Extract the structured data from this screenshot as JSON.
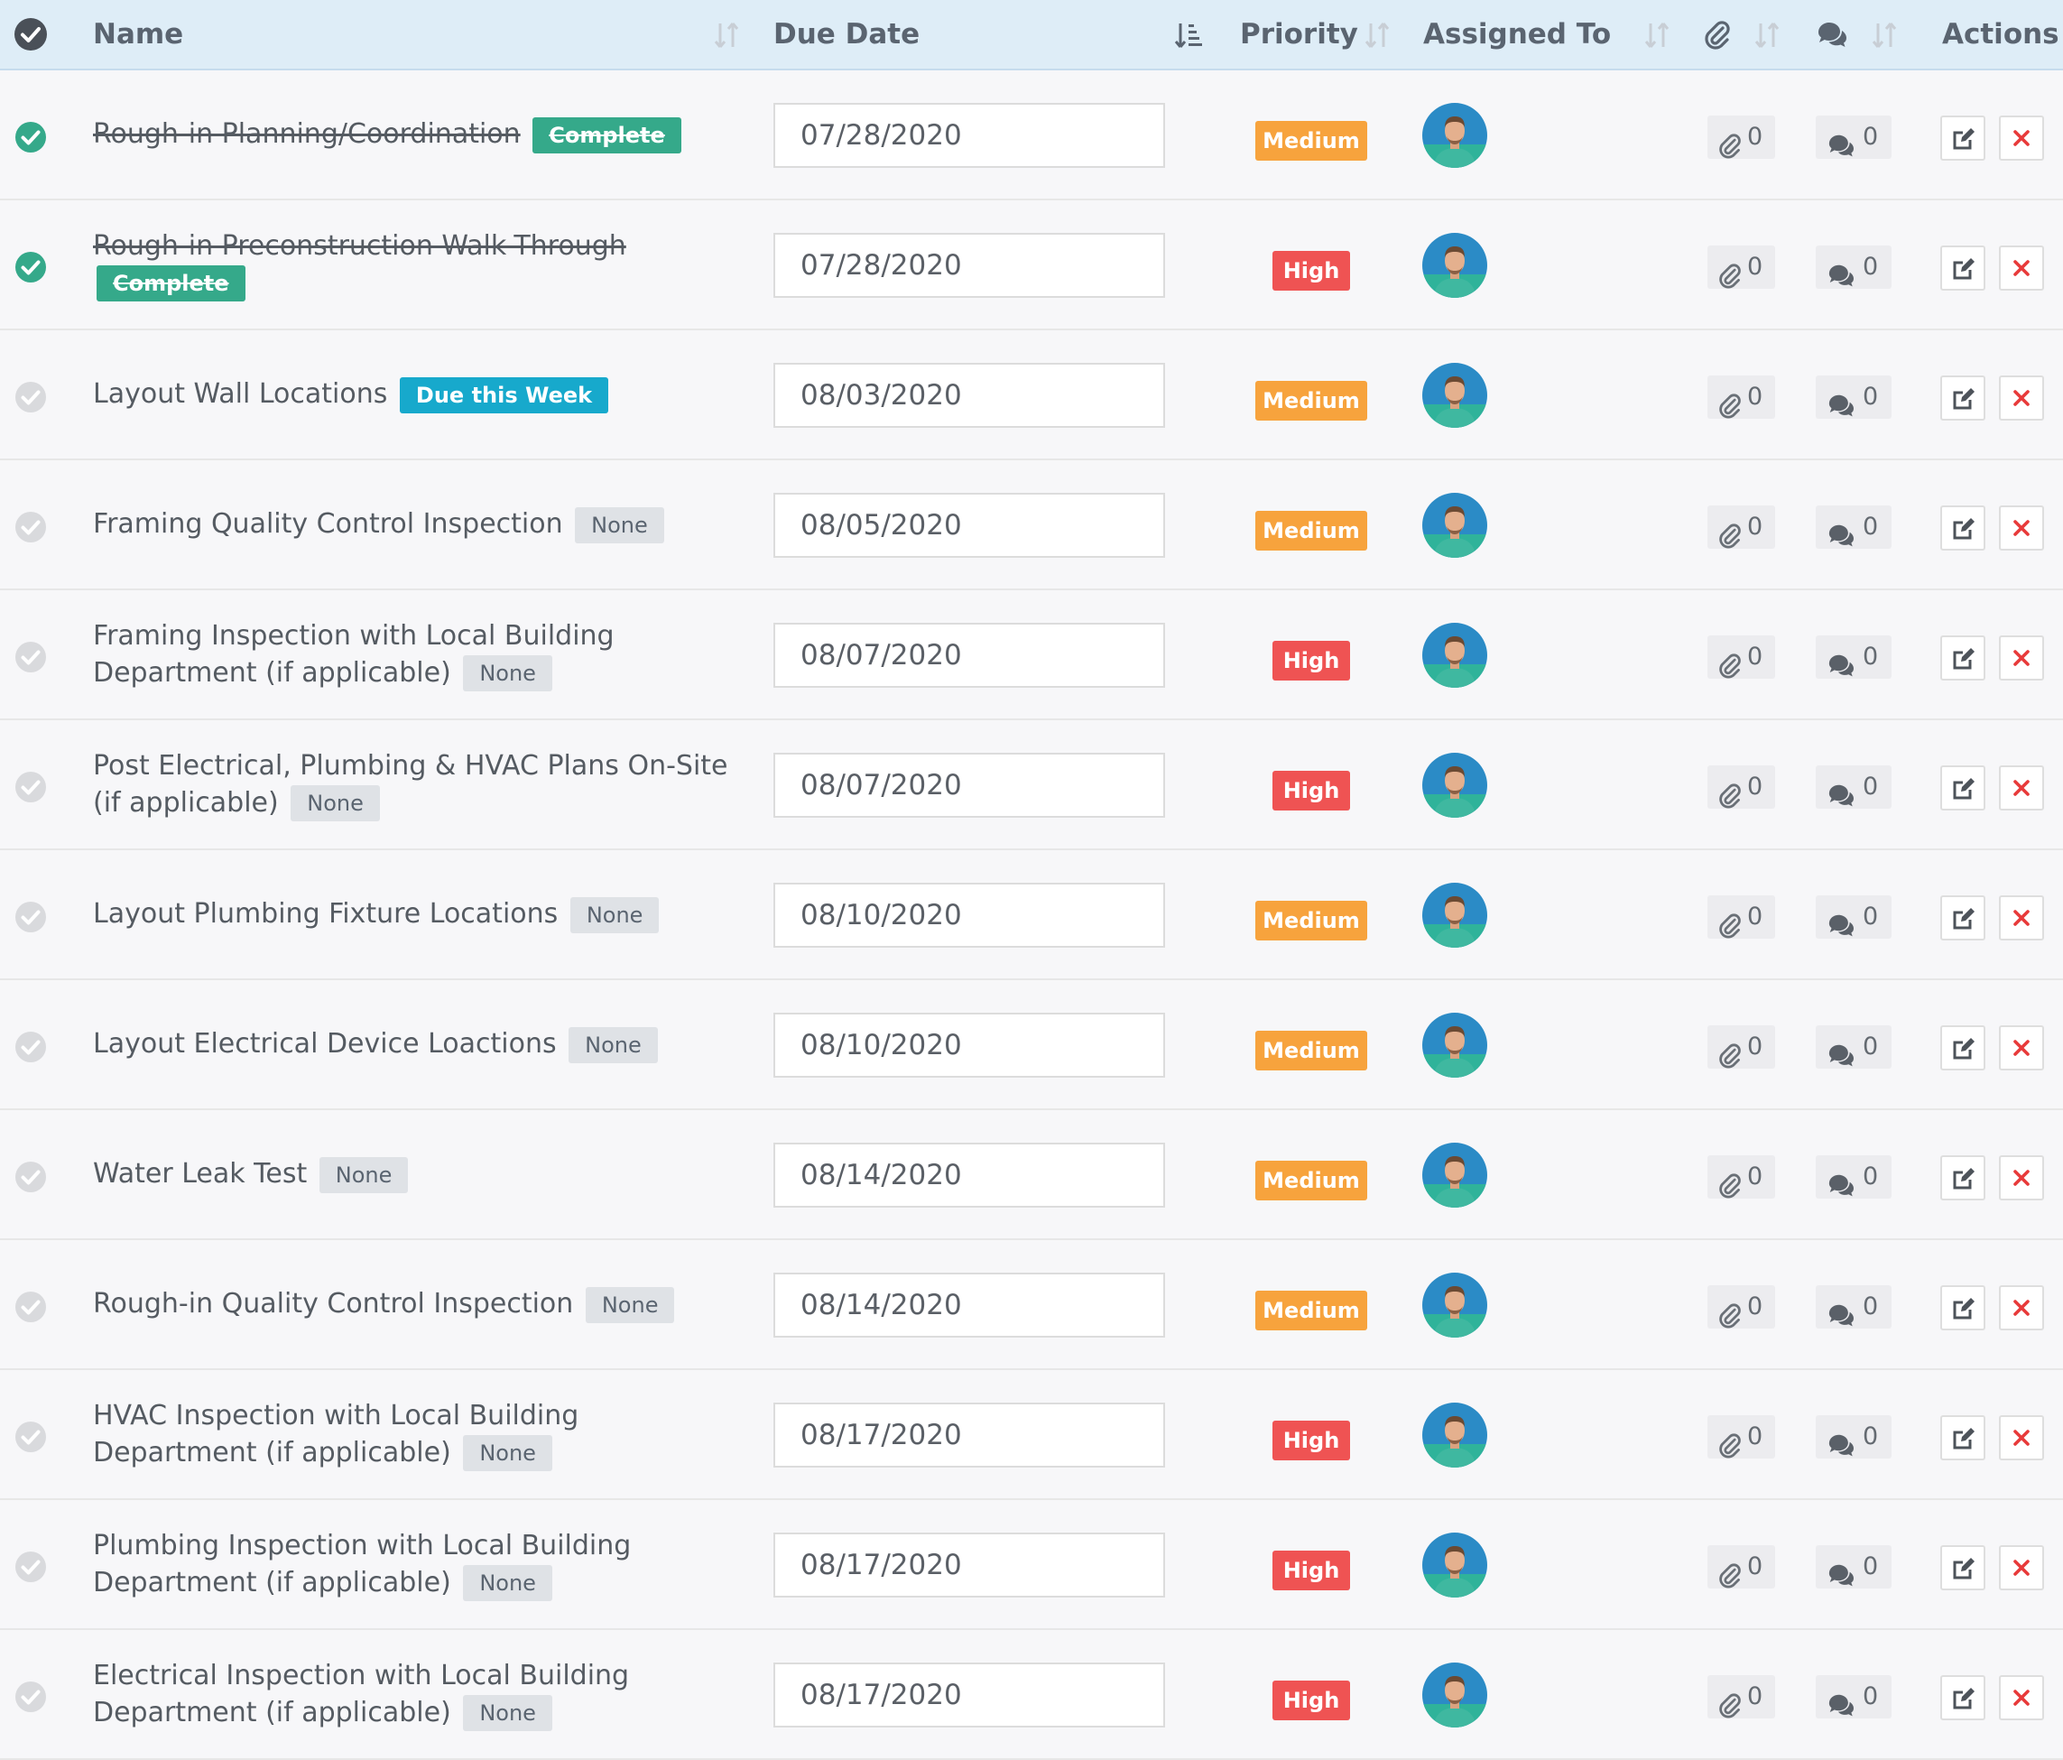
{
  "header": {
    "name": "Name",
    "due_date": "Due Date",
    "priority": "Priority",
    "assigned_to": "Assigned To",
    "actions": "Actions"
  },
  "colors": {
    "header_bg": "#deedf7",
    "complete_green": "#35a98a",
    "medium_orange": "#f7a33d",
    "high_red": "#ef5353",
    "due_week_blue": "#17a9cc",
    "delete_red": "#e83a3a"
  },
  "tasks": [
    {
      "name": "Rough-in Planning/Coordination",
      "status": "Complete",
      "done": true,
      "due": "07/28/2020",
      "priority": "Medium",
      "attachments": "0",
      "comments": "0"
    },
    {
      "name": "Rough-in Preconstruction Walk-Through",
      "status": "Complete",
      "done": true,
      "due": "07/28/2020",
      "priority": "High",
      "attachments": "0",
      "comments": "0"
    },
    {
      "name": "Layout Wall Locations",
      "status": "Due this Week",
      "done": false,
      "due": "08/03/2020",
      "priority": "Medium",
      "attachments": "0",
      "comments": "0"
    },
    {
      "name": "Framing Quality Control Inspection",
      "status": "None",
      "done": false,
      "due": "08/05/2020",
      "priority": "Medium",
      "attachments": "0",
      "comments": "0"
    },
    {
      "name": "Framing Inspection with Local Building Department (if applicable)",
      "status": "None",
      "done": false,
      "due": "08/07/2020",
      "priority": "High",
      "attachments": "0",
      "comments": "0"
    },
    {
      "name": "Post Electrical, Plumbing & HVAC Plans On-Site (if applicable)",
      "status": "None",
      "done": false,
      "due": "08/07/2020",
      "priority": "High",
      "attachments": "0",
      "comments": "0"
    },
    {
      "name": "Layout Plumbing Fixture Locations",
      "status": "None",
      "done": false,
      "due": "08/10/2020",
      "priority": "Medium",
      "attachments": "0",
      "comments": "0"
    },
    {
      "name": "Layout Electrical Device Loactions",
      "status": "None",
      "done": false,
      "due": "08/10/2020",
      "priority": "Medium",
      "attachments": "0",
      "comments": "0"
    },
    {
      "name": "Water Leak Test",
      "status": "None",
      "done": false,
      "due": "08/14/2020",
      "priority": "Medium",
      "attachments": "0",
      "comments": "0"
    },
    {
      "name": "Rough-in Quality Control Inspection",
      "status": "None",
      "done": false,
      "due": "08/14/2020",
      "priority": "Medium",
      "attachments": "0",
      "comments": "0"
    },
    {
      "name": "HVAC Inspection with Local Building Department (if applicable)",
      "status": "None",
      "done": false,
      "due": "08/17/2020",
      "priority": "High",
      "attachments": "0",
      "comments": "0"
    },
    {
      "name": "Plumbing Inspection with Local Building Department (if applicable)",
      "status": "None",
      "done": false,
      "due": "08/17/2020",
      "priority": "High",
      "attachments": "0",
      "comments": "0"
    },
    {
      "name": "Electrical Inspection with Local Building Department (if applicable)",
      "status": "None",
      "done": false,
      "due": "08/17/2020",
      "priority": "High",
      "attachments": "0",
      "comments": "0"
    }
  ]
}
